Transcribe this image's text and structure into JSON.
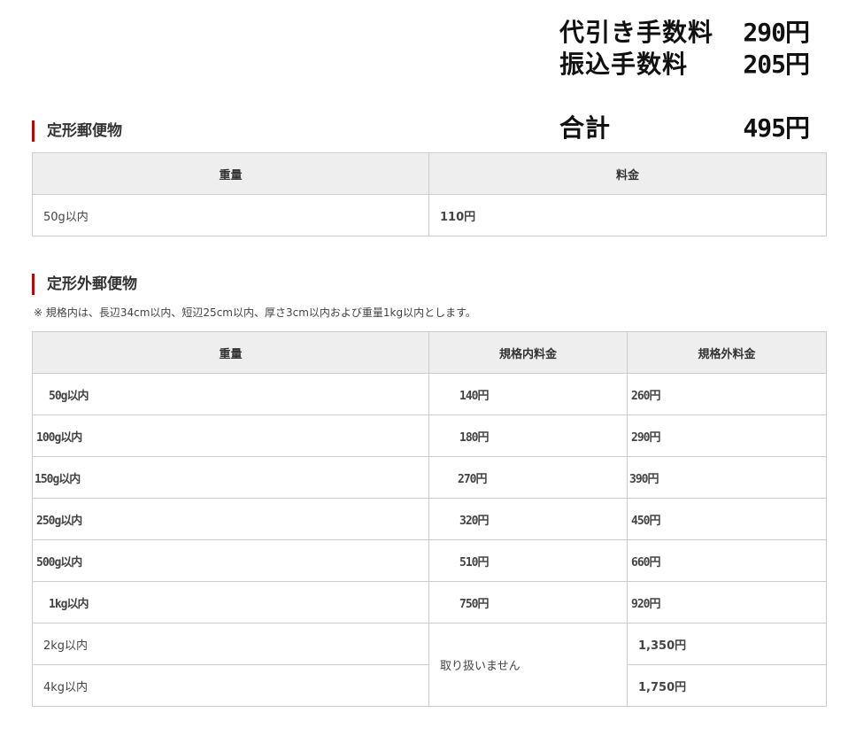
{
  "fees": [
    {
      "label": "代引き手数料",
      "value": "290円"
    },
    {
      "label": "振込手数料",
      "value": "205円"
    },
    {
      "label": "合計",
      "value": "495円"
    }
  ],
  "standard": {
    "title": "定形郵便物",
    "headers": [
      "重量",
      "料金"
    ],
    "rows": [
      {
        "weight": "50g以内",
        "price": "110円"
      }
    ]
  },
  "nonstandard": {
    "title": "定形外郵便物",
    "note": "※ 規格内は、長辺34cm以内、短辺25cm以内、厚さ3cm以内および重量1kg以内とします。",
    "headers": [
      "重量",
      "規格内料金",
      "規格外料金"
    ],
    "rows": [
      {
        "weight": "50g以内",
        "inside": "140円",
        "outside": "260円"
      },
      {
        "weight": "100g以内",
        "inside": "180円",
        "outside": "290円"
      },
      {
        "weight": "150g以内",
        "inside": "270円",
        "outside": "390円"
      },
      {
        "weight": "250g以内",
        "inside": "320円",
        "outside": "450円"
      },
      {
        "weight": "500g以内",
        "inside": "510円",
        "outside": "660円"
      },
      {
        "weight": "1kg以内",
        "inside": "750円",
        "outside": "920円"
      },
      {
        "weight": "2kg以内",
        "outside": "1,350円"
      },
      {
        "weight": "4kg以内",
        "outside": "1,750円"
      }
    ],
    "not_handled": "取り扱いません"
  }
}
